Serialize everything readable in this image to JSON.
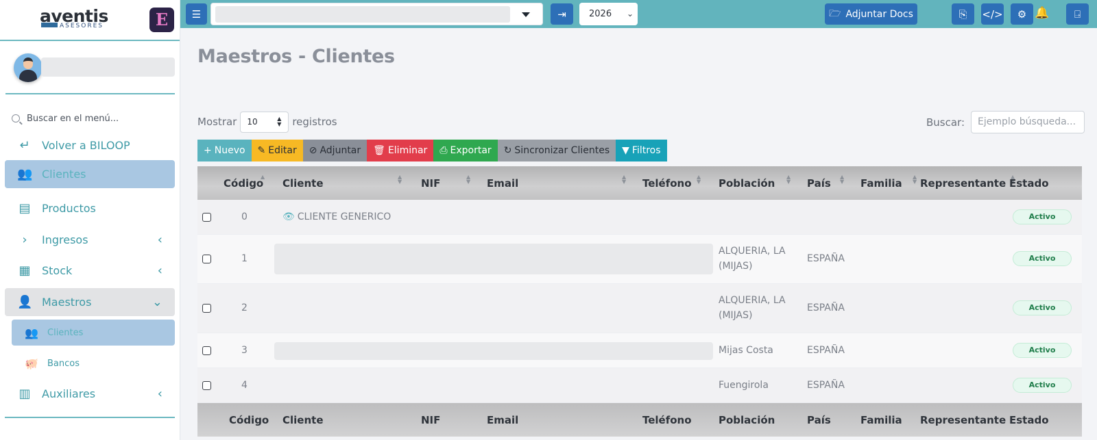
{
  "brand": {
    "name": "aventis",
    "tagline": "ASESORES",
    "app_badge": "E"
  },
  "sidebar": {
    "search_placeholder": "Buscar en el menú...",
    "items": [
      {
        "label": "Volver a BILOOP",
        "icon": "return-arrow-icon"
      },
      {
        "label": "Clientes",
        "icon": "users-icon",
        "active": true
      },
      {
        "label": "Productos",
        "icon": "archive-box-icon"
      },
      {
        "label": "Ingresos",
        "icon": "chevron-right-icon"
      },
      {
        "label": "Stock",
        "icon": "pallet-icon"
      },
      {
        "label": "Maestros",
        "icon": "user-tie-icon"
      },
      {
        "label": "Auxiliares",
        "icon": "building-icon"
      }
    ],
    "subitems": [
      {
        "label": "Clientes",
        "icon": "users-icon",
        "active": true
      },
      {
        "label": "Bancos",
        "icon": "piggy-bank-icon"
      }
    ]
  },
  "topbar": {
    "year": "2026",
    "attach_docs": "Adjuntar Docs"
  },
  "page": {
    "title": "Maestros - Clientes"
  },
  "table_controls": {
    "show_label": "Mostrar",
    "page_length": "10",
    "records_label": "registros",
    "search_label": "Buscar:",
    "search_placeholder": "Ejemplo búsqueda..."
  },
  "actions": [
    {
      "label": "Nuevo",
      "icon": "+",
      "color": "#5ab3be"
    },
    {
      "label": "Editar",
      "icon": "✎",
      "color": "#f7b924"
    },
    {
      "label": "Adjuntar",
      "icon": "⊘",
      "color": "#8a8f98"
    },
    {
      "label": "Eliminar",
      "icon": "🗑",
      "color": "#e23d4b"
    },
    {
      "label": "Exportar",
      "icon": "⎙",
      "color": "#2fa84f"
    },
    {
      "label": "Sincronizar Clientes",
      "icon": "↻",
      "color": "#9a9fa6"
    },
    {
      "label": "Filtros",
      "icon": "▼",
      "color": "#18a2b8"
    }
  ],
  "table": {
    "columns": [
      "Código",
      "Cliente",
      "NIF",
      "Email",
      "Teléfono",
      "Población",
      "País",
      "Familia",
      "Representante",
      "Estado"
    ],
    "rows": [
      {
        "codigo": "0",
        "cliente": "CLIENTE GENERICO",
        "poblacion": "",
        "pais": "",
        "estado": "Activo"
      },
      {
        "codigo": "1",
        "cliente": "",
        "poblacion": "ALQUERIA, LA (MIJAS)",
        "pais": "ESPAÑA",
        "estado": "Activo"
      },
      {
        "codigo": "2",
        "cliente": "",
        "poblacion": "ALQUERIA, LA (MIJAS)",
        "pais": "ESPAÑA",
        "estado": "Activo"
      },
      {
        "codigo": "3",
        "cliente": "",
        "poblacion": "Mijas Costa",
        "pais": "ESPAÑA",
        "estado": "Activo"
      },
      {
        "codigo": "4",
        "cliente": "",
        "poblacion": "Fuengirola",
        "pais": "ESPAÑA",
        "estado": "Activo"
      }
    ]
  }
}
